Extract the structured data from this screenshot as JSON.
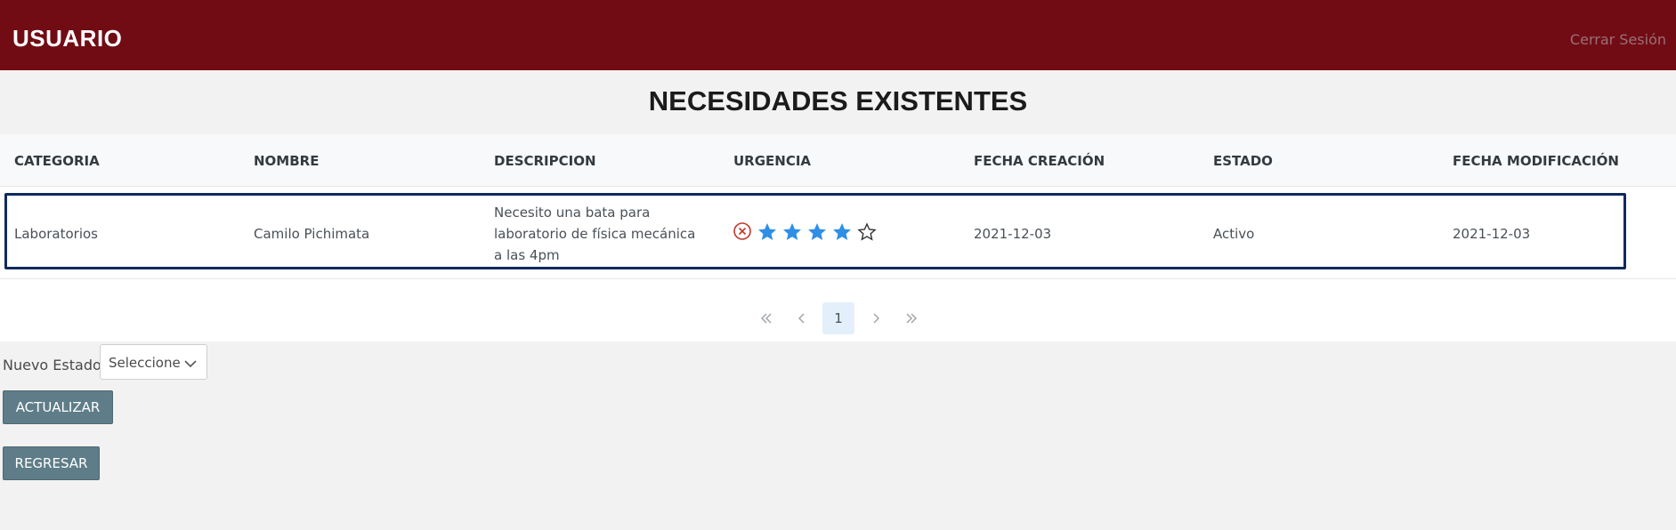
{
  "header": {
    "brand": "USUARIO",
    "logout": "Cerrar Sesión",
    "background_color": "#710c15"
  },
  "page": {
    "title": "NECESIDADES EXISTENTES"
  },
  "table": {
    "columns": [
      "CATEGORIA",
      "NOMBRE",
      "DESCRIPCION",
      "URGENCIA",
      "FECHA CREACIÓN",
      "ESTADO",
      "FECHA MODIFICACIÓN"
    ],
    "rows": [
      {
        "categoria": "Laboratorios",
        "nombre": "Camilo Pichimata",
        "descripcion": "Necesito una bata para laboratorio de física mecánica a las 4pm",
        "urgencia": {
          "rating": 4,
          "max": 5,
          "clear_icon": "cancel-icon",
          "star_color": "#2f8fe6"
        },
        "fecha_creacion": "2021-12-03",
        "estado": "Activo",
        "fecha_modificacion": "2021-12-03"
      }
    ]
  },
  "paginator": {
    "first_icon": "double-chevron-left-icon",
    "prev_icon": "chevron-left-icon",
    "current_page": "1",
    "next_icon": "chevron-right-icon",
    "last_icon": "double-chevron-right-icon"
  },
  "form": {
    "status_label": "Nuevo Estado:",
    "select_value": "Seleccione",
    "update_button": "ACTUALIZAR",
    "back_button": "REGRESAR",
    "button_color": "#5f7d89"
  }
}
